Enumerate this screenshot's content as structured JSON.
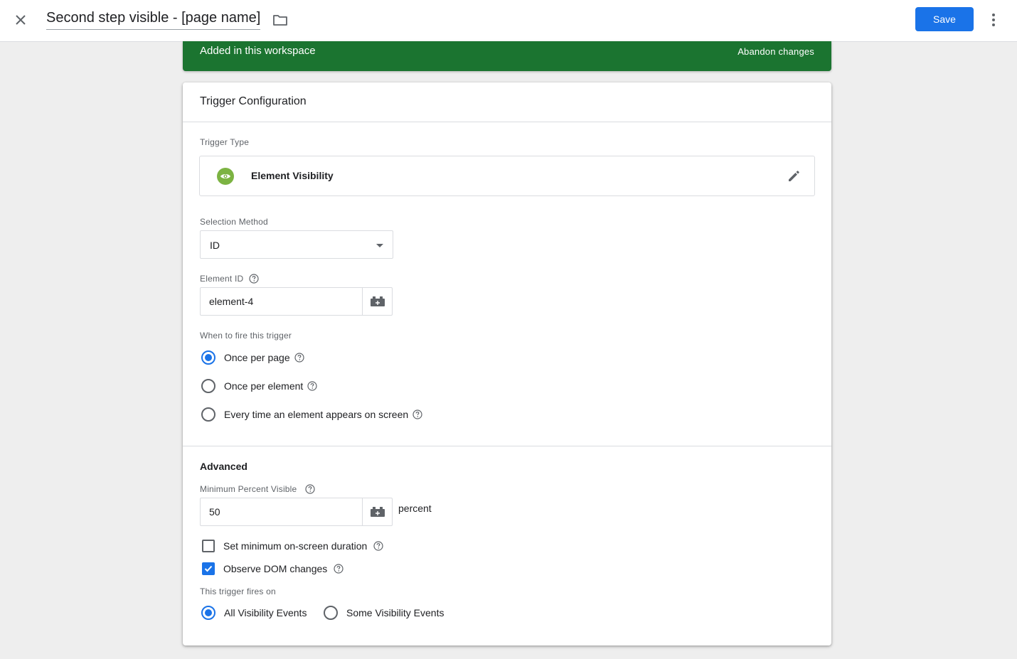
{
  "topbar": {
    "title": "Second step visible - [page name]",
    "save_label": "Save"
  },
  "banner": {
    "text": "Added in this workspace",
    "abandon_label": "Abandon changes"
  },
  "card": {
    "title": "Trigger Configuration",
    "trigger_type_label": "Trigger Type",
    "trigger_type_name": "Element Visibility",
    "selection_method_label": "Selection Method",
    "selection_method_value": "ID",
    "element_id_label": "Element ID",
    "element_id_value": "element-4",
    "fire_label": "When to fire this trigger",
    "fire_options": [
      {
        "label": "Once per page",
        "checked": true
      },
      {
        "label": "Once per element",
        "checked": false
      },
      {
        "label": "Every time an element appears on screen",
        "checked": false
      }
    ],
    "advanced_title": "Advanced",
    "min_percent_label": "Minimum Percent Visible",
    "min_percent_value": "50",
    "min_percent_unit": "percent",
    "min_duration_label": "Set minimum on-screen duration",
    "min_duration_checked": false,
    "observe_dom_label": "Observe DOM changes",
    "observe_dom_checked": true,
    "fires_on_label": "This trigger fires on",
    "fires_on_options": [
      {
        "label": "All Visibility Events",
        "checked": true
      },
      {
        "label": "Some Visibility Events",
        "checked": false
      }
    ]
  },
  "colors": {
    "accent": "#1a73e8",
    "banner": "#1b7430",
    "trigger_icon": "#7cb342"
  },
  "icons": {
    "close": "close-icon",
    "folder": "folder-icon",
    "more": "more-vert-icon",
    "trigger": "eye-icon",
    "edit": "pencil-icon",
    "variable": "variable-brick-icon",
    "help": "help-icon"
  }
}
